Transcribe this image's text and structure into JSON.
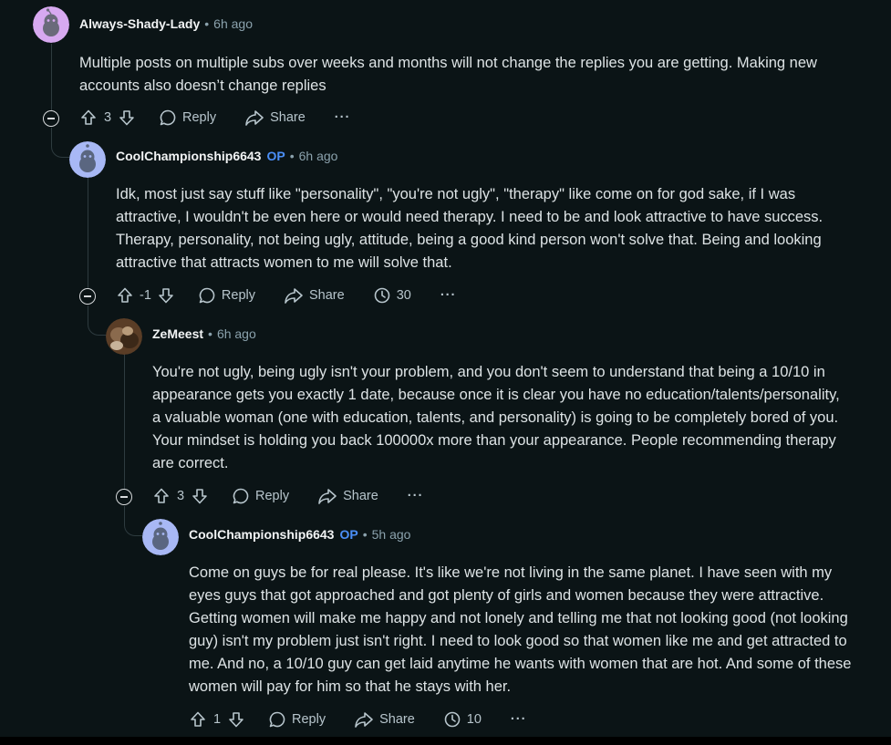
{
  "comments": [
    {
      "author": "Always-Shady-Lady",
      "op_label": "",
      "time": "6h ago",
      "body": "Multiple posts on multiple subs over weeks and months will not change the replies you are getting. Making new accounts also doesn’t change replies",
      "score": "3",
      "reply_label": "Reply",
      "share_label": "Share",
      "award_count": "",
      "avatar_color": "#d7a9f0"
    },
    {
      "author": "CoolChampionship6643",
      "op_label": "OP",
      "time": "6h ago",
      "body": "Idk, most just say stuff like \"personality\", \"you're not ugly\", \"therapy\" like come on for god sake, if I was attractive, I wouldn't be even here or would need therapy. I need to be and look attractive to have success. Therapy, personality, not being ugly, attitude, being a good kind person won't solve that. Being and looking attractive that attracts women to me will solve that.",
      "score": "-1",
      "reply_label": "Reply",
      "share_label": "Share",
      "award_count": "30",
      "avatar_color": "#a8b8f5"
    },
    {
      "author": "ZeMeest",
      "op_label": "",
      "time": "6h ago",
      "body": "You're not ugly, being ugly isn't your problem, and you don't seem to understand that being a 10/10 in appearance gets you exactly 1 date, because once it is clear you have no education/talents/personality, a valuable woman (one with education, talents, and personality) is going to be completely bored of you. Your mindset is holding you back 100000x more than your appearance. People recommending therapy are correct.",
      "score": "3",
      "reply_label": "Reply",
      "share_label": "Share",
      "award_count": "",
      "avatar_color": "#6b4a2e"
    },
    {
      "author": "CoolChampionship6643",
      "op_label": "OP",
      "time": "5h ago",
      "body": "Come on guys be for real please. It's like we're not living in the same planet. I have seen with my eyes guys that got approached and got plenty of girls and women because they were attractive. Getting women will make me happy and not lonely and telling me that not looking good (not looking guy) isn't my problem just isn't right. I need to look good so that women like me and get attracted to me. And no, a 10/10 guy can get laid anytime he wants with women that are hot. And some of these women will pay for him so that he stays with her.",
      "score": "1",
      "reply_label": "Reply",
      "share_label": "Share",
      "award_count": "10",
      "avatar_color": "#a8b8f5"
    }
  ],
  "ui": {
    "separator": "•",
    "more_glyph": "···"
  }
}
